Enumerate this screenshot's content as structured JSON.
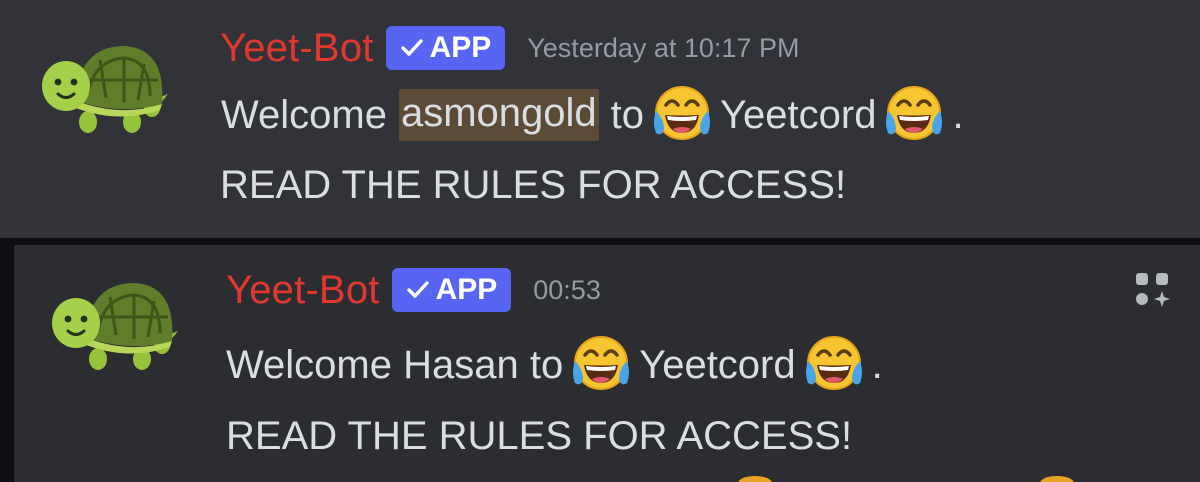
{
  "messages": [
    {
      "author": "Yeet-Bot",
      "badge": "APP",
      "timestamp": "Yesterday at 10:17 PM",
      "line1": {
        "prefix": "Welcome",
        "mention": "asmongold",
        "mid": "to",
        "server": "Yeetcord",
        "suffix": "."
      },
      "line2": "READ THE RULES FOR ACCESS!"
    },
    {
      "author": "Yeet-Bot",
      "badge": "APP",
      "timestamp": "00:53",
      "line1": {
        "prefix": "Welcome Hasan to",
        "server": "Yeetcord",
        "suffix": "."
      },
      "line2": "READ THE RULES FOR ACCESS!"
    }
  ],
  "icons": {
    "avatar": "turtle-icon",
    "emoji": "face-with-tears-of-joy-icon",
    "badge_check": "checkmark-icon",
    "apps": "app-actions-icon"
  },
  "colors": {
    "username": "#e0372f",
    "badge": "#5865f2",
    "mention_highlight": "#5c4c37",
    "timestamp": "#949ba4",
    "text": "#dbdee1",
    "panel_top": "#313338",
    "panel_bottom": "#2b2d31"
  }
}
